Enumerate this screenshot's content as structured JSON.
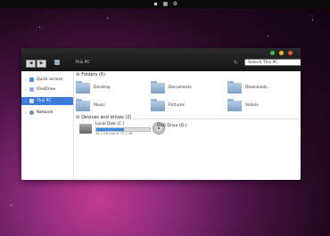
{
  "window": {
    "path": "This PC",
    "search_placeholder": "Search This PC"
  },
  "sidebar": {
    "items": [
      {
        "label": "Quick access"
      },
      {
        "label": "OneDrive"
      },
      {
        "label": "This PC"
      },
      {
        "label": "Network"
      }
    ]
  },
  "folders": {
    "header": "Folders (6)",
    "items": [
      {
        "label": "Desktop"
      },
      {
        "label": "Documents"
      },
      {
        "label": "Downloads"
      },
      {
        "label": "Music"
      },
      {
        "label": "Pictures"
      },
      {
        "label": "Videos"
      }
    ]
  },
  "devices": {
    "header": "Devices and drives (2)",
    "local_disk": {
      "name": "Local Disk (C:)",
      "free": "34.2 GB free of 70.1 GB",
      "used_fraction": 0.51
    },
    "dvd": {
      "name": "DVD Drive (D:)"
    }
  },
  "colors": {
    "selection": "#3d7bd8",
    "close": "#e05a3b",
    "minimize": "#f0b429",
    "maximize": "#4cb54a"
  }
}
